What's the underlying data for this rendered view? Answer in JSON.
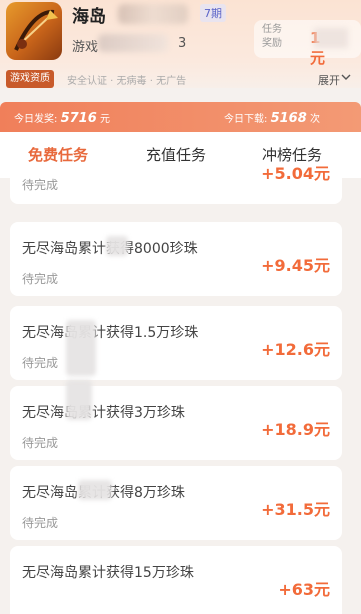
{
  "header": {
    "app_name": "海岛",
    "period_badge": "7期",
    "subtitle_prefix": "游戏",
    "subtitle_suffix": "3",
    "reward_label": "任务奖励",
    "reward_value_suffix": "元"
  },
  "info": {
    "badge": "游戏资质",
    "items": "安全认证 · 无病毒 · 无广告",
    "expand_label": "展开"
  },
  "stats": {
    "payout_label": "今日发奖:",
    "payout_value": "5716",
    "payout_unit": "元",
    "downloads_label": "今日下载:",
    "downloads_value": "5168",
    "downloads_unit": "次"
  },
  "tabs": [
    "免费任务",
    "充值任务",
    "冲榜任务"
  ],
  "tasks": [
    {
      "title": "",
      "status": "待完成",
      "reward": "+5.04元"
    },
    {
      "title": "无尽海岛累计获得8000珍珠",
      "status": "待完成",
      "reward": "+9.45元"
    },
    {
      "title": "无尽海岛累计获得1.5万珍珠",
      "status": "待完成",
      "reward": "+12.6元"
    },
    {
      "title": "无尽海岛累计获得3万珍珠",
      "status": "待完成",
      "reward": "+18.9元"
    },
    {
      "title": "无尽海岛累计获得8万珍珠",
      "status": "待完成",
      "reward": "+31.5元"
    },
    {
      "title": "无尽海岛累计获得15万珍珠",
      "status": "",
      "reward": "+63元"
    }
  ],
  "colors": {
    "accent": "#e8693c",
    "reward": "#f26b3a",
    "banner": "#f07f5a"
  }
}
